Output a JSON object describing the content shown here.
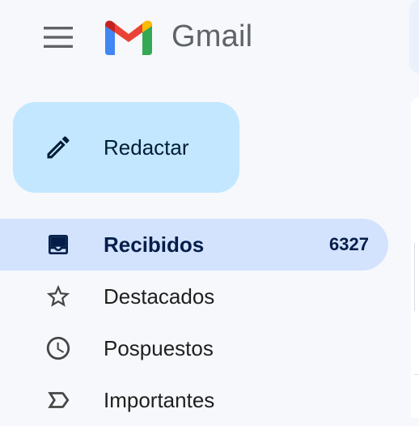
{
  "header": {
    "app_name": "Gmail",
    "menu_icon": "hamburger-menu-icon",
    "logo_icon": "gmail-m-logo"
  },
  "compose": {
    "label": "Redactar",
    "icon": "pencil-icon",
    "color": "#c2e7ff"
  },
  "nav": {
    "items": [
      {
        "label": "Recibidos",
        "count": "6327",
        "icon": "inbox-icon",
        "active": true
      },
      {
        "label": "Destacados",
        "count": "",
        "icon": "star-icon",
        "active": false
      },
      {
        "label": "Pospuestos",
        "count": "",
        "icon": "clock-icon",
        "active": false
      },
      {
        "label": "Importantes",
        "count": "",
        "icon": "important-icon",
        "active": false
      }
    ]
  },
  "colors": {
    "background": "#f6f8fc",
    "active_nav": "#d3e3fd",
    "gmail_red": "#ea4335",
    "gmail_blue": "#4285f4",
    "gmail_green": "#34a853",
    "gmail_yellow": "#fbbc04"
  }
}
